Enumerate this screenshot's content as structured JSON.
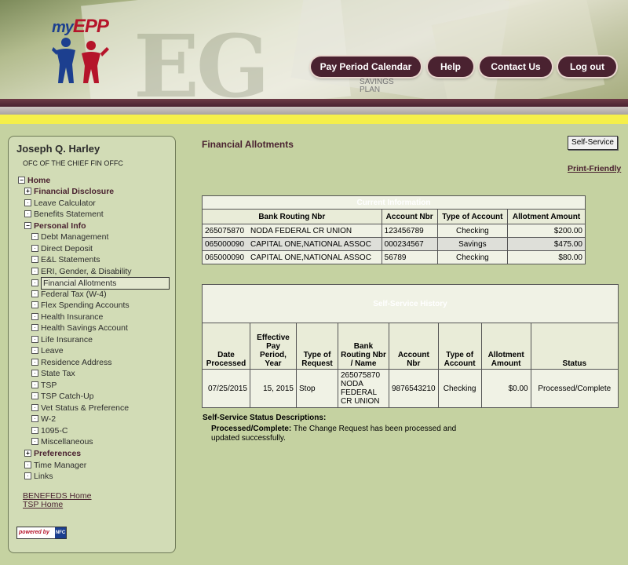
{
  "header": {
    "savings_line1": "SAVINGS",
    "savings_line2": "PLAN",
    "logo_text_my": "my",
    "logo_text_epp": "EPP",
    "nav": {
      "pay_period": "Pay Period Calendar",
      "help": "Help",
      "contact": "Contact Us",
      "logout": "Log out"
    }
  },
  "sidebar": {
    "user_name": "Joseph Q. Harley",
    "user_org": "OFC OF THE CHIEF FIN OFFC",
    "items": [
      {
        "label": "Home",
        "mark": "−"
      },
      {
        "label": "Financial Disclosure",
        "mark": "+"
      },
      {
        "label": "Leave Calculator",
        "mark": "·"
      },
      {
        "label": "Benefits Statement",
        "mark": "·"
      },
      {
        "label": "Personal Info",
        "mark": "−"
      },
      {
        "label": "Debt Management",
        "mark": "·"
      },
      {
        "label": "Direct Deposit",
        "mark": "·"
      },
      {
        "label": "E&L Statements",
        "mark": "·"
      },
      {
        "label": "ERI, Gender, & Disability",
        "mark": "·"
      },
      {
        "label": "Financial Allotments",
        "mark": "·"
      },
      {
        "label": "Federal Tax (W-4)",
        "mark": "·"
      },
      {
        "label": "Flex Spending Accounts",
        "mark": "·"
      },
      {
        "label": "Health Insurance",
        "mark": "·"
      },
      {
        "label": "Health Savings Account",
        "mark": "·"
      },
      {
        "label": "Life Insurance",
        "mark": "·"
      },
      {
        "label": "Leave",
        "mark": "·"
      },
      {
        "label": "Residence Address",
        "mark": "·"
      },
      {
        "label": "State Tax",
        "mark": "·"
      },
      {
        "label": "TSP",
        "mark": "·"
      },
      {
        "label": "TSP Catch-Up",
        "mark": "·"
      },
      {
        "label": "Vet Status & Preference",
        "mark": "·"
      },
      {
        "label": "W-2",
        "mark": "·"
      },
      {
        "label": "1095-C",
        "mark": "·"
      },
      {
        "label": "Miscellaneous",
        "mark": "·"
      },
      {
        "label": "Preferences",
        "mark": "+"
      },
      {
        "label": "Time Manager",
        "mark": "·"
      },
      {
        "label": "Links",
        "mark": "·"
      }
    ],
    "links": {
      "benefeds": "BENEFEDS Home",
      "tsp": "TSP Home"
    },
    "powered_by": "powered by",
    "nfc": "NFC"
  },
  "main": {
    "title": "Financial Allotments",
    "self_service_button": "Self-Service",
    "print_friendly": "Print-Friendly",
    "current": {
      "caption": "Current Information",
      "headers": [
        "Bank Routing Nbr",
        "Account Nbr",
        "Type of Account",
        "Allotment Amount"
      ],
      "rows": [
        {
          "routing": "265075870",
          "bank": "NODA FEDERAL CR UNION",
          "account": "123456789",
          "type": "Checking",
          "amount": "$200.00"
        },
        {
          "routing": "065000090",
          "bank": "CAPITAL ONE,NATIONAL ASSOC",
          "account": "000234567",
          "type": "Savings",
          "amount": "$475.00"
        },
        {
          "routing": "065000090",
          "bank": "CAPITAL ONE,NATIONAL ASSOC",
          "account": "56789",
          "type": "Checking",
          "amount": "$80.00"
        }
      ]
    },
    "history": {
      "caption": "Self-Service History",
      "headers": [
        "Date Processed",
        "Effective Pay Period, Year",
        "Type of Request",
        "Bank Routing Nbr / Name",
        "Account Nbr",
        "Type of Account",
        "Allotment Amount",
        "Status"
      ],
      "rows": [
        {
          "date": "07/25/2015",
          "period": "15, 2015",
          "request": "Stop",
          "routing": "265075870 NODA FEDERAL CR UNION",
          "account": "9876543210",
          "type": "Checking",
          "amount": "$0.00",
          "status": "Processed/Complete"
        }
      ]
    },
    "descriptions": {
      "title": "Self-Service Status Descriptions:",
      "term": "Processed/Complete:",
      "text": " The Change Request has been processed and updated successfully."
    }
  }
}
